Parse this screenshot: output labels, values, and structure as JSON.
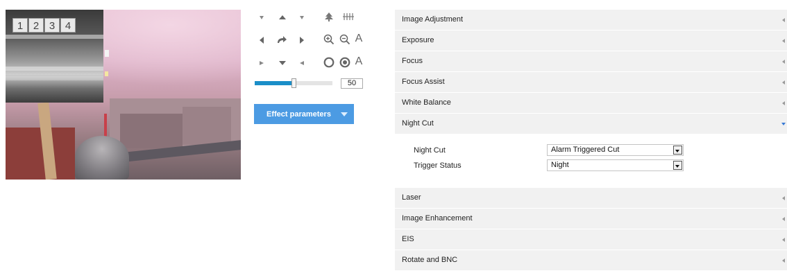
{
  "preview": {
    "split_buttons": [
      "1",
      "2",
      "3",
      "4"
    ]
  },
  "ptz": {
    "speed_value": "50",
    "speed_fraction": 0.5,
    "zoom_labels": [
      "A",
      "A"
    ]
  },
  "effect": {
    "label": "Effect parameters"
  },
  "accordion": {
    "sections_top": [
      {
        "label": "Image Adjustment"
      },
      {
        "label": "Exposure"
      },
      {
        "label": "Focus"
      },
      {
        "label": "Focus Assist"
      },
      {
        "label": "White Balance"
      }
    ],
    "open_section": {
      "label": "Night Cut"
    },
    "night_cut": {
      "night_cut_label": "Night Cut",
      "night_cut_value": "Alarm Triggered Cut",
      "trigger_status_label": "Trigger Status",
      "trigger_status_value": "Night"
    },
    "sections_bottom": [
      {
        "label": "Laser"
      },
      {
        "label": "Image Enhancement"
      },
      {
        "label": "EIS"
      },
      {
        "label": "Rotate and BNC"
      }
    ]
  },
  "colors": {
    "accent": "#4c9be3",
    "slider_fill": "#1b8ec8",
    "header_bg": "#f1f1f1"
  }
}
